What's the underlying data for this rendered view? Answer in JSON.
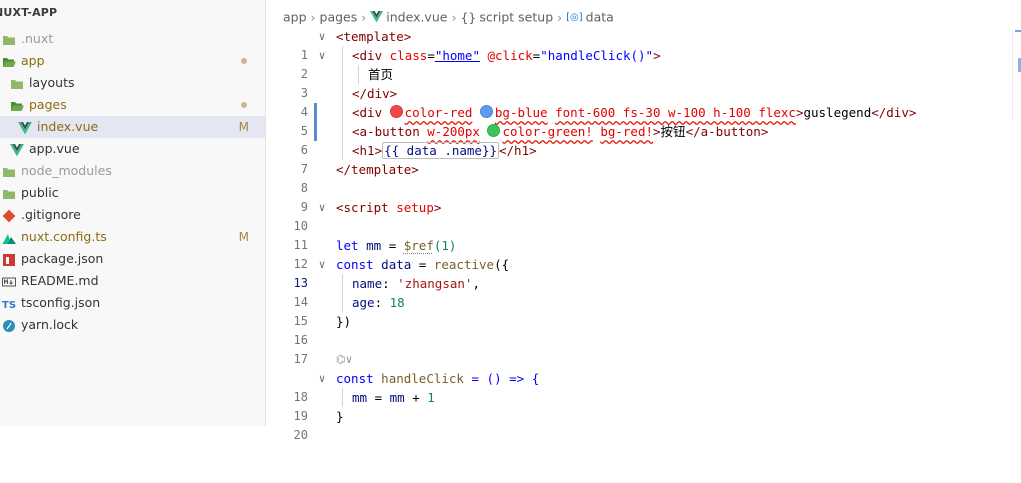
{
  "explorer": {
    "title": "NUXT-APP",
    "items": [
      {
        "label": ".nuxt",
        "icon": "folder-icon",
        "indent": 0,
        "dim": true
      },
      {
        "label": "app",
        "icon": "folder-open-icon",
        "indent": 0,
        "mod": true,
        "dot": true
      },
      {
        "label": "layouts",
        "icon": "folder-icon",
        "indent": 1
      },
      {
        "label": "pages",
        "icon": "folder-open-icon",
        "indent": 1,
        "mod": true,
        "dot": true
      },
      {
        "label": "index.vue",
        "icon": "vue-icon",
        "indent": 2,
        "mod": true,
        "badge": "M",
        "selected": true
      },
      {
        "label": "app.vue",
        "icon": "vue-icon",
        "indent": 1
      },
      {
        "label": "node_modules",
        "icon": "folder-icon",
        "indent": 0,
        "dim": true
      },
      {
        "label": "public",
        "icon": "folder-icon",
        "indent": 0
      },
      {
        "label": ".gitignore",
        "icon": "git-icon",
        "indent": 0
      },
      {
        "label": "nuxt.config.ts",
        "icon": "nuxt-icon",
        "indent": 0,
        "mod": true,
        "badge": "M"
      },
      {
        "label": "package.json",
        "icon": "npm-icon",
        "indent": 0
      },
      {
        "label": "README.md",
        "icon": "markdown-icon",
        "indent": 0
      },
      {
        "label": "tsconfig.json",
        "icon": "ts-icon",
        "indent": 0
      },
      {
        "label": "yarn.lock",
        "icon": "yarn-icon",
        "indent": 0
      }
    ]
  },
  "breadcrumb": {
    "app": "app",
    "pages": "pages",
    "file": "index.vue",
    "scope": "script setup",
    "symbol": "data",
    "scope_icon": "{}",
    "symbol_icon": "[◎]"
  },
  "code": {
    "n1": "1",
    "n2": "2",
    "n3": "3",
    "n4": "4",
    "n5": "5",
    "n6": "6",
    "n7": "7",
    "n8": "8",
    "n9": "9",
    "n10": "10",
    "n11": "11",
    "n12": "12",
    "n13": "13",
    "n14": "14",
    "n15": "15",
    "n16": "16",
    "n17": "17",
    "n18": "18",
    "n19": "19",
    "n20": "20",
    "l1": "<template>",
    "l2_open": "<div ",
    "l2_attr1": "class",
    "l2_eq1": "=",
    "l2_val1": "\"home\"",
    "l2_attr2": "@click",
    "l2_eq2": "=",
    "l2_val2": "\"handleClick()\"",
    "l2_close": ">",
    "l3": "首页",
    "l4": "</div>",
    "l5_open": "<div ",
    "l5_c1": "color-red",
    "l5_c2": "bg-blue",
    "l5_rest": "font-600 fs-30 w-100 h-100 flexc",
    "l5_text": "guslegend",
    "l5_close": "</div>",
    "l6_open": "<a-button ",
    "l6_w": "w-200px",
    "l6_c": "color-green!",
    "l6_bg": "bg-red!",
    "l6_text": "按钮",
    "l6_close": "</a-button>",
    "l7_open": "<h1>",
    "l7_interp": "{{ data .name}}",
    "l7_close": "</h1>",
    "l8": "</template>",
    "l10_open": "<script ",
    "l10_attr": "setup",
    "l10_close": ">",
    "l12_kw": "let",
    "l12_var": "mm",
    "l12_op": " = ",
    "l12_fn": "$ref",
    "l12_rest": "(1)",
    "l13_kw": "const",
    "l13_var": "data",
    "l13_op": " = ",
    "l13_fn": "reactive",
    "l13_rest": "({",
    "l14_key": "name",
    "l14_val": "'zhangsan'",
    "l15_key": "age",
    "l15_val": "18",
    "l16": "})",
    "lens": "⌬∨",
    "l18_kw": "const",
    "l18_fn": "handleClick",
    "l18_rest": " = () => {",
    "l19_var1": "mm",
    "l19_mid": " = ",
    "l19_var2": "mm",
    "l19_plus": " + ",
    "l19_num": "1",
    "l20": "}"
  },
  "colors": {
    "red_swatch": "#f44747",
    "blue_swatch": "#5b9bf0",
    "green_swatch": "#3cc55a"
  }
}
